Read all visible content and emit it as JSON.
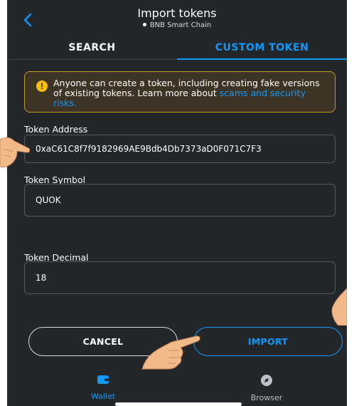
{
  "header": {
    "title": "Import tokens",
    "network": "BNB Smart Chain",
    "back_icon": "chevron-left-icon"
  },
  "tabs": [
    {
      "label": "SEARCH",
      "active": false
    },
    {
      "label": "CUSTOM TOKEN",
      "active": true
    }
  ],
  "warning": {
    "icon": "exclamation-icon",
    "text": "Anyone can create a token, including creating fake versions of existing tokens. Learn more about ",
    "link": "scams and security risks."
  },
  "form": {
    "address_label": "Token Address",
    "address_value": "0xaC61C8f7f9182969AE9Bdb4Db7373aD0F071C7F3",
    "symbol_label": "Token Symbol",
    "symbol_value": "QUOK",
    "decimal_label": "Token Decimal",
    "decimal_value": "18"
  },
  "actions": {
    "cancel_label": "CANCEL",
    "import_label": "IMPORT"
  },
  "bottom_nav": [
    {
      "label": "Wallet",
      "icon": "wallet-icon",
      "active": true
    },
    {
      "label": "Browser",
      "icon": "compass-icon",
      "active": false
    }
  ],
  "colors": {
    "background": "#24272a",
    "accent": "#1098fc",
    "warning_border": "#c79a30",
    "warning_bg": "#3d3425"
  }
}
